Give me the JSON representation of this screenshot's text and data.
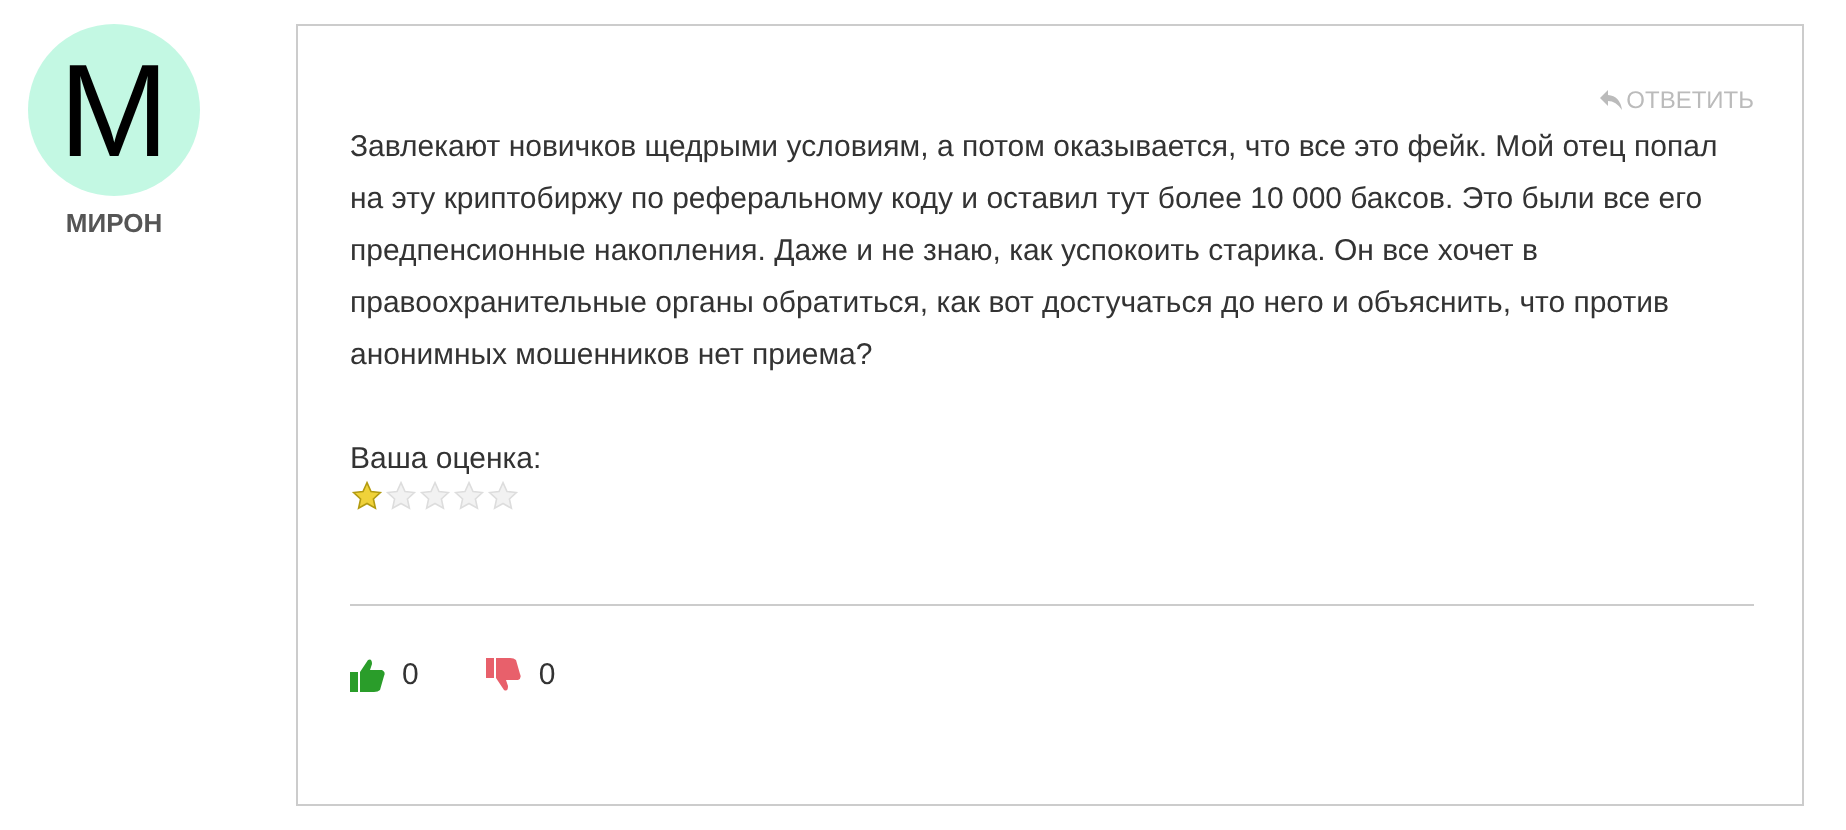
{
  "author": {
    "initial": "М",
    "name": "МИРОН"
  },
  "comment": {
    "reply": "ОТВЕТИТЬ",
    "text": "Завлекают новичков щедрыми условиям, а потом оказывается, что все это фейк. Мой отец попал на эту криптобиржу по реферальному коду и оставил тут более 10 000 баксов. Это были все его предпенсионные накопления. Даже и не знаю, как успокоить старика. Он все хочет в правоохранительные органы обратиться, как вот достучаться до него и объяснить, что против анонимных мошенников нет приема?",
    "rating_label": "Ваша оценка:",
    "stars": 1,
    "votes": [
      {
        "kind": "up",
        "count": "0"
      },
      {
        "kind": "down",
        "count": "0"
      }
    ]
  }
}
